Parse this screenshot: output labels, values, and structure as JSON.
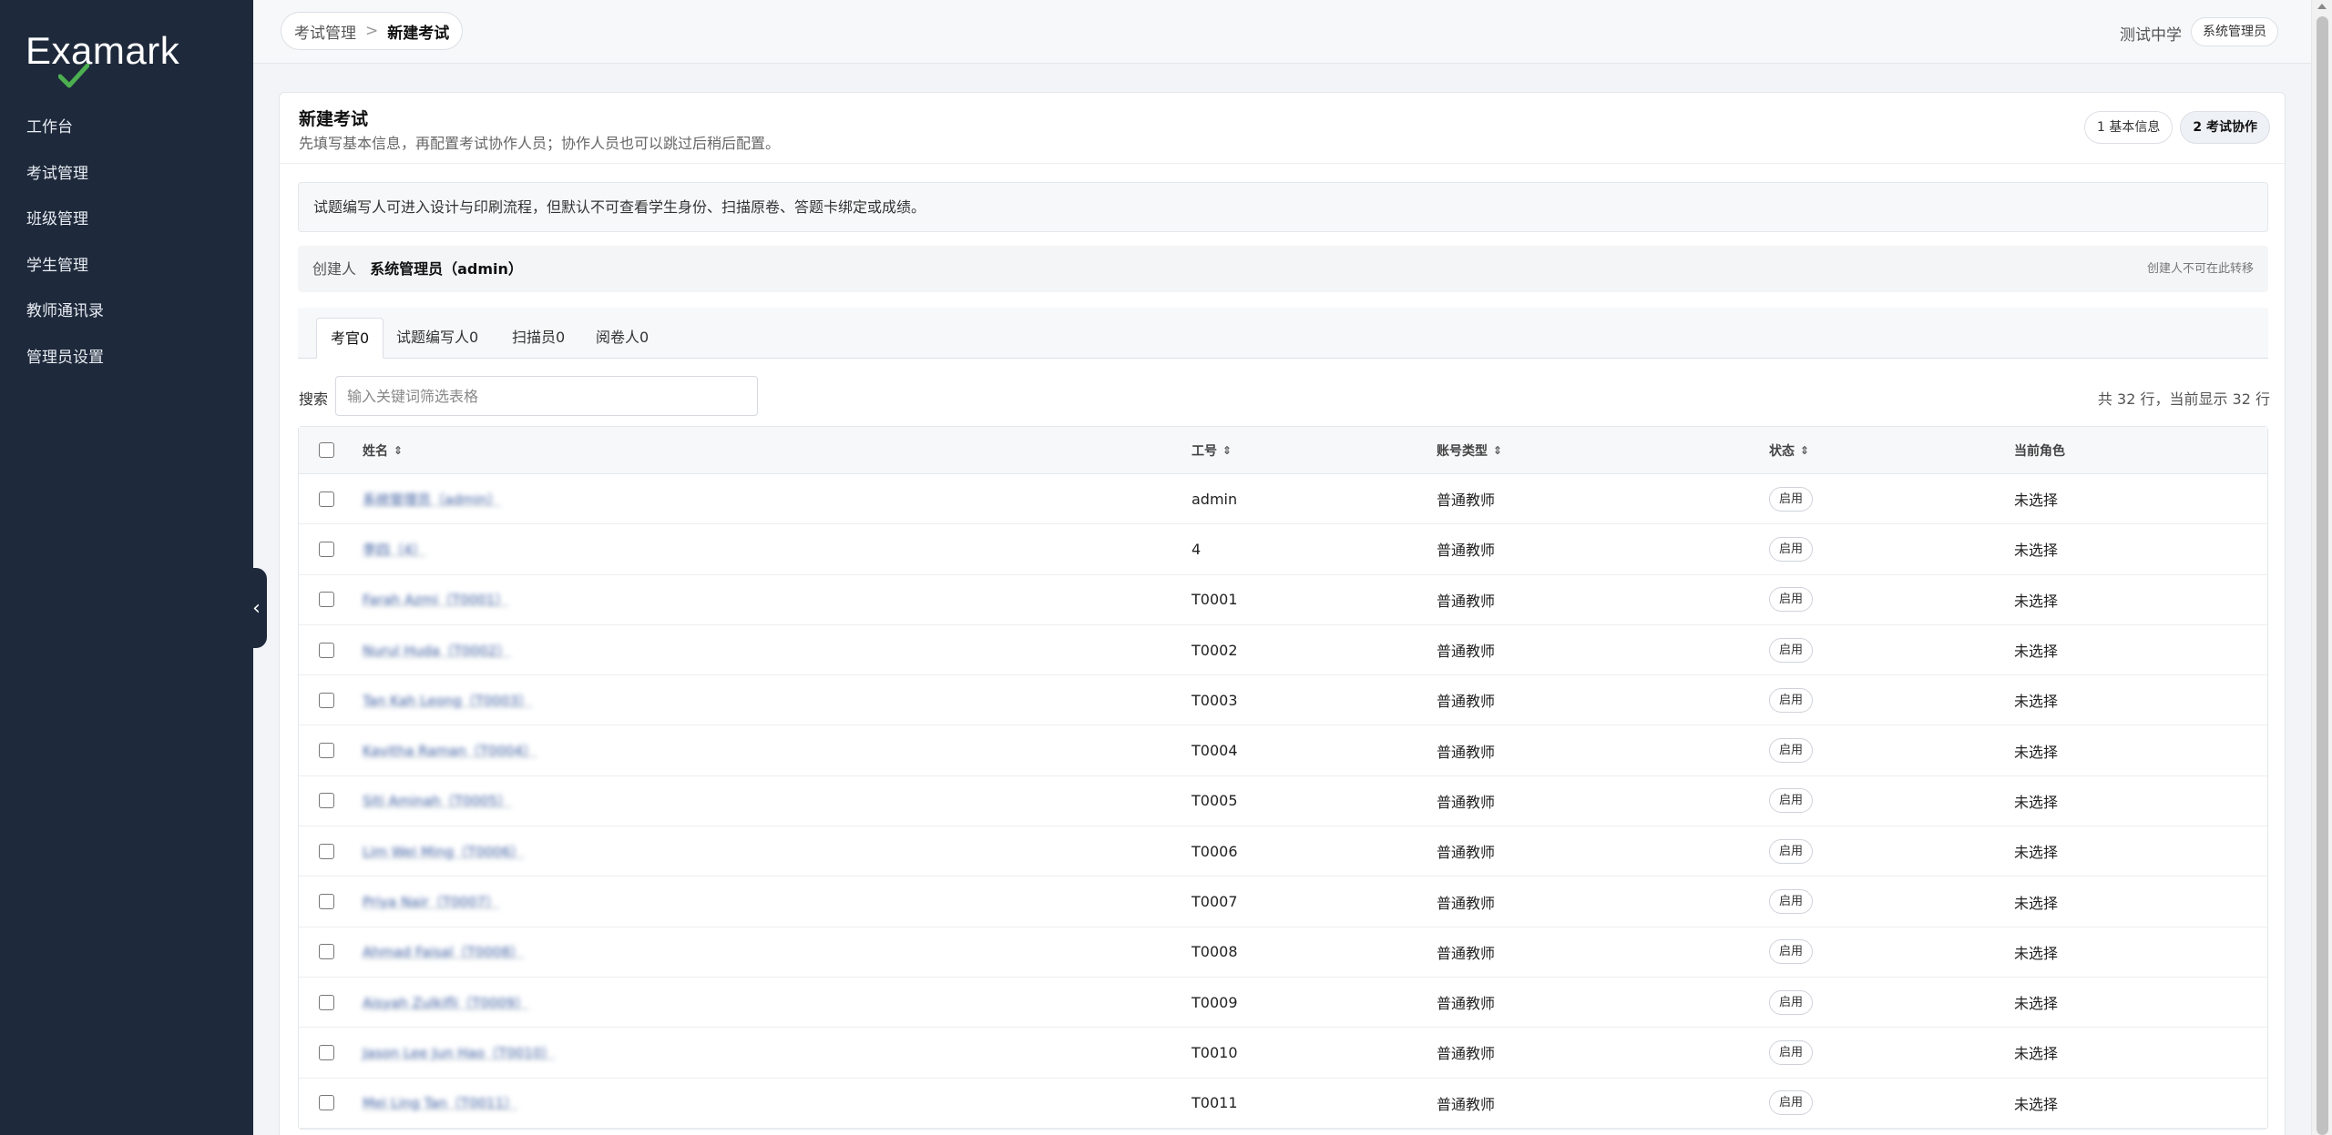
{
  "app": {
    "logo_text": "Examark"
  },
  "sidebar": {
    "items": [
      {
        "label": "工作台"
      },
      {
        "label": "考试管理"
      },
      {
        "label": "班级管理"
      },
      {
        "label": "学生管理"
      },
      {
        "label": "教师通讯录"
      },
      {
        "label": "管理员设置"
      }
    ]
  },
  "header": {
    "breadcrumb": {
      "parent": "考试管理",
      "separator": ">",
      "current": "新建考试"
    },
    "school": "测试中学",
    "user_role": "系统管理员"
  },
  "page": {
    "title": "新建考试",
    "subtitle": "先填写基本信息，再配置考试协作人员；协作人员也可以跳过后稍后配置。",
    "steps": [
      {
        "label": "1 基本信息",
        "active": false
      },
      {
        "label": "2 考试协作",
        "active": true
      }
    ],
    "notice": "试题编写人可进入设计与印刷流程，但默认不可查看学生身份、扫描原卷、答题卡绑定或成绩。",
    "creator": {
      "label": "创建人",
      "name": "系统管理员（admin）",
      "note": "创建人不可在此转移"
    },
    "tabs": [
      {
        "label": "考官0",
        "active": true
      },
      {
        "label": "试题编写人0",
        "active": false
      },
      {
        "label": "扫描员0",
        "active": false
      },
      {
        "label": "阅卷人0",
        "active": false
      }
    ],
    "search": {
      "label": "搜索",
      "placeholder": "输入关键词筛选表格",
      "value": ""
    },
    "row_count": "共 32 行，当前显示 32 行"
  },
  "table": {
    "headers": {
      "name": "姓名",
      "id": "工号",
      "type": "账号类型",
      "status": "状态",
      "role": "当前角色"
    },
    "rows": [
      {
        "name": "系统管理员（admin）",
        "id": "admin",
        "type": "普通教师",
        "status": "启用",
        "role": "未选择"
      },
      {
        "name": "李四（4）",
        "id": "4",
        "type": "普通教师",
        "status": "启用",
        "role": "未选择"
      },
      {
        "name": "Farah Azmi（T0001）",
        "id": "T0001",
        "type": "普通教师",
        "status": "启用",
        "role": "未选择"
      },
      {
        "name": "Nurul Huda（T0002）",
        "id": "T0002",
        "type": "普通教师",
        "status": "启用",
        "role": "未选择"
      },
      {
        "name": "Tan Kah Leong（T0003）",
        "id": "T0003",
        "type": "普通教师",
        "status": "启用",
        "role": "未选择"
      },
      {
        "name": "Kavitha Raman（T0004）",
        "id": "T0004",
        "type": "普通教师",
        "status": "启用",
        "role": "未选择"
      },
      {
        "name": "Siti Aminah（T0005）",
        "id": "T0005",
        "type": "普通教师",
        "status": "启用",
        "role": "未选择"
      },
      {
        "name": "Lim Wei Ming（T0006）",
        "id": "T0006",
        "type": "普通教师",
        "status": "启用",
        "role": "未选择"
      },
      {
        "name": "Priya Nair（T0007）",
        "id": "T0007",
        "type": "普通教师",
        "status": "启用",
        "role": "未选择"
      },
      {
        "name": "Ahmad Faisal（T0008）",
        "id": "T0008",
        "type": "普通教师",
        "status": "启用",
        "role": "未选择"
      },
      {
        "name": "Aisyah Zulkifli（T0009）",
        "id": "T0009",
        "type": "普通教师",
        "status": "启用",
        "role": "未选择"
      },
      {
        "name": "Jason Lee Jun Hao（T0010）",
        "id": "T0010",
        "type": "普通教师",
        "status": "启用",
        "role": "未选择"
      },
      {
        "name": "Mei Ling Tan（T0011）",
        "id": "T0011",
        "type": "普通教师",
        "status": "启用",
        "role": "未选择"
      }
    ]
  },
  "colors": {
    "sidebar_bg": "#1e293b",
    "page_bg": "#f2f4f7",
    "text": "#222222"
  }
}
